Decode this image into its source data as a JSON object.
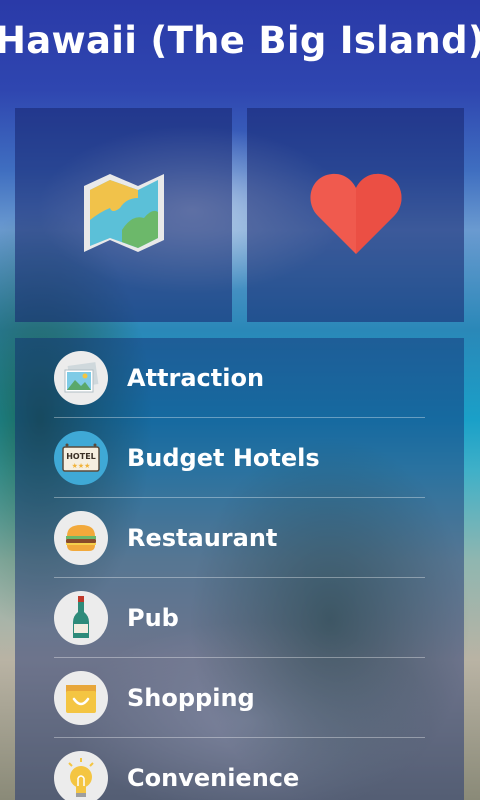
{
  "header": {
    "title": "Hawaii (The Big Island)"
  },
  "tiles": [
    {
      "icon": "map-icon"
    },
    {
      "icon": "heart-icon"
    }
  ],
  "menu": {
    "items": [
      {
        "label": "Attraction",
        "icon": "photo-icon"
      },
      {
        "label": "Budget Hotels",
        "icon": "hotel-sign-icon",
        "icon_text": "HOTEL"
      },
      {
        "label": "Restaurant",
        "icon": "burger-icon"
      },
      {
        "label": "Pub",
        "icon": "wine-bottle-icon"
      },
      {
        "label": "Shopping",
        "icon": "shopping-bag-icon"
      },
      {
        "label": "Convenience",
        "icon": "lightbulb-icon"
      }
    ]
  },
  "colors": {
    "header_bg": "#2a3aa8",
    "heart": "#f05a4e",
    "text": "#ffffff"
  }
}
